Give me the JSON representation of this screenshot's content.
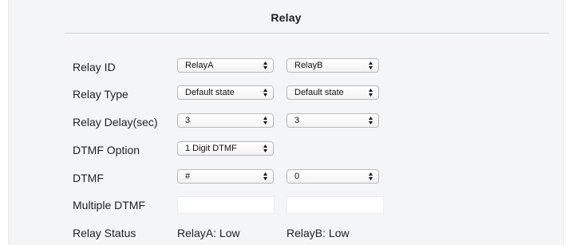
{
  "section": {
    "title": "Relay"
  },
  "rows": {
    "relay_id": {
      "label": "Relay ID",
      "a_value": "RelayA",
      "b_value": "RelayB"
    },
    "relay_type": {
      "label": "Relay Type",
      "a_value": "Default state",
      "b_value": "Default state"
    },
    "relay_delay": {
      "label": "Relay Delay(sec)",
      "a_value": "3",
      "b_value": "3"
    },
    "dtmf_option": {
      "label": "DTMF Option",
      "a_value": "1 Digit DTMF"
    },
    "dtmf": {
      "label": "DTMF",
      "a_value": "#",
      "b_value": "0"
    },
    "multiple_dtmf": {
      "label": "Multiple DTMF",
      "a_value": "",
      "b_value": ""
    },
    "relay_status": {
      "label": "Relay Status",
      "a_status": "RelayA: Low",
      "b_status": "RelayB: Low"
    }
  },
  "icons": {
    "select_arrows": "up-down-chevron-icon"
  },
  "colors": {
    "panel_background": "#f4f5f7",
    "title_rule": "#c9d6e6",
    "select_border": "#b9b9b9"
  }
}
